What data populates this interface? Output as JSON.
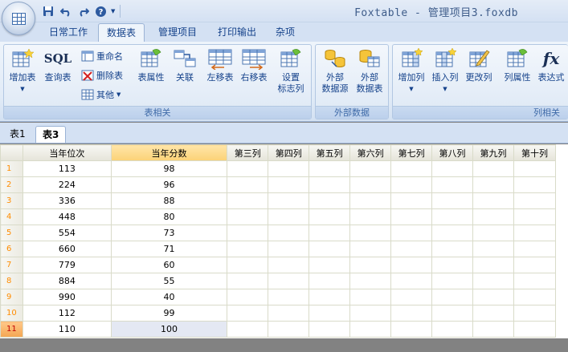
{
  "window": {
    "title": "Foxtable - 管理项目3.foxdb"
  },
  "menu_tabs": [
    "日常工作",
    "数据表",
    "管理项目",
    "打印输出",
    "杂项"
  ],
  "ribbon": {
    "group_table": {
      "label": "表相关",
      "add_table": "增加表",
      "sql_label": "SQL",
      "query_table": "查询表",
      "rename": "重命名",
      "delete_table": "删除表",
      "other": "其他",
      "table_props": "表属性",
      "relation": "关联",
      "move_left": "左移表",
      "move_right": "右移表",
      "flag_col_line1": "设置",
      "flag_col_line2": "标志列"
    },
    "group_external": {
      "label": "外部数据",
      "ext_source_line1": "外部",
      "ext_source_line2": "数据源",
      "ext_table_line1": "外部",
      "ext_table_line2": "数据表"
    },
    "group_column": {
      "label": "列相关",
      "add_col": "增加列",
      "insert_col": "插入列",
      "change_col": "更改列",
      "col_props": "列属性",
      "fx_glyph": "fx",
      "expression": "表达式"
    }
  },
  "sheet_tabs": [
    "表1",
    "表3"
  ],
  "grid": {
    "columns": [
      "当年位次",
      "当年分数",
      "第三列",
      "第四列",
      "第五列",
      "第六列",
      "第七列",
      "第八列",
      "第九列",
      "第十列"
    ],
    "rows": [
      {
        "n": "1",
        "rank": "113",
        "score": "98"
      },
      {
        "n": "2",
        "rank": "224",
        "score": "96"
      },
      {
        "n": "3",
        "rank": "336",
        "score": "88"
      },
      {
        "n": "4",
        "rank": "448",
        "score": "80"
      },
      {
        "n": "5",
        "rank": "554",
        "score": "73"
      },
      {
        "n": "6",
        "rank": "660",
        "score": "71"
      },
      {
        "n": "7",
        "rank": "779",
        "score": "60"
      },
      {
        "n": "8",
        "rank": "884",
        "score": "55"
      },
      {
        "n": "9",
        "rank": "990",
        "score": "40"
      },
      {
        "n": "10",
        "rank": "112",
        "score": "99"
      },
      {
        "n": "11",
        "rank": "110",
        "score": "100"
      }
    ]
  }
}
